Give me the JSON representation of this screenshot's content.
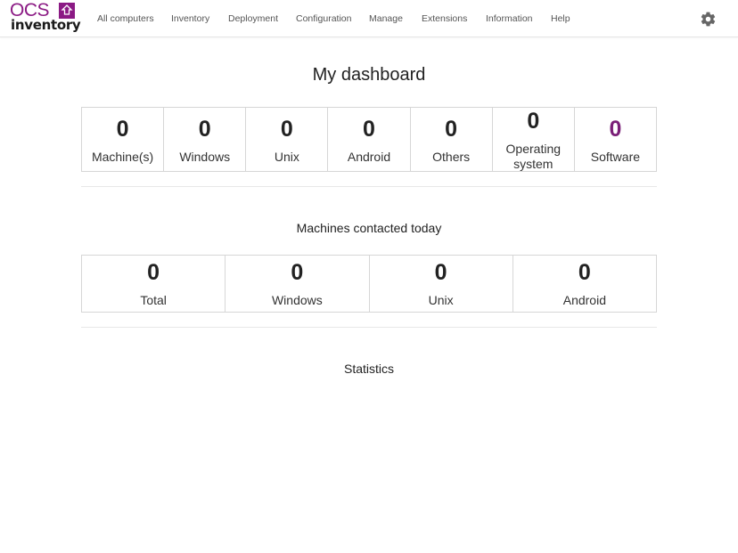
{
  "brand": {
    "ocs": "OCS",
    "inventory": "inventory",
    "color": "#8b1a84"
  },
  "nav": {
    "items": [
      {
        "label": "All computers"
      },
      {
        "label": "Inventory"
      },
      {
        "label": "Deployment"
      },
      {
        "label": "Configuration"
      },
      {
        "label": "Manage"
      },
      {
        "label": "Extensions"
      },
      {
        "label": "Information"
      },
      {
        "label": "Help"
      }
    ],
    "settings_icon": "gear-icon"
  },
  "dashboard": {
    "title": "My dashboard",
    "summary": [
      {
        "value": "0",
        "label": "Machine(s)"
      },
      {
        "value": "0",
        "label": "Windows"
      },
      {
        "value": "0",
        "label": "Unix"
      },
      {
        "value": "0",
        "label": "Android"
      },
      {
        "value": "0",
        "label": "Others"
      },
      {
        "value": "0",
        "label": "Operating system"
      },
      {
        "value": "0",
        "label": "Software",
        "color": "#7a1f77"
      }
    ],
    "contacted_title": "Machines contacted today",
    "contacted": [
      {
        "value": "0",
        "label": "Total"
      },
      {
        "value": "0",
        "label": "Windows"
      },
      {
        "value": "0",
        "label": "Unix"
      },
      {
        "value": "0",
        "label": "Android"
      }
    ],
    "statistics_title": "Statistics"
  }
}
